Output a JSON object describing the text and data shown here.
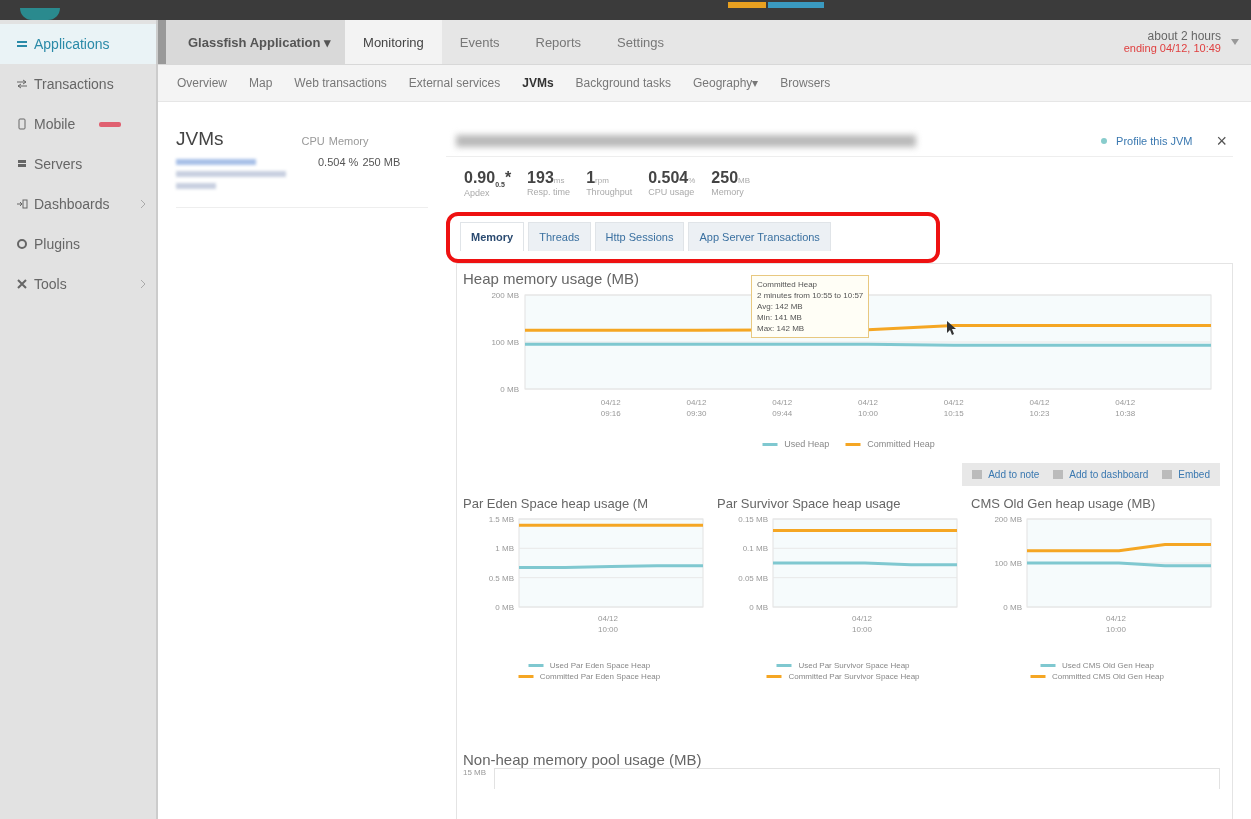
{
  "sidebar": {
    "items": [
      {
        "label": "Applications",
        "selected": true,
        "badge": false,
        "submenu": false
      },
      {
        "label": "Transactions",
        "selected": false,
        "badge": false,
        "submenu": false
      },
      {
        "label": "Mobile",
        "selected": false,
        "badge": true,
        "submenu": false
      },
      {
        "label": "Servers",
        "selected": false,
        "badge": false,
        "submenu": false
      },
      {
        "label": "Dashboards",
        "selected": false,
        "badge": false,
        "submenu": true
      },
      {
        "label": "Plugins",
        "selected": false,
        "badge": false,
        "submenu": false
      },
      {
        "label": "Tools",
        "selected": false,
        "badge": false,
        "submenu": true
      }
    ]
  },
  "app_selector": {
    "label": "Glassfish Application",
    "caret": "▾"
  },
  "main_tabs": [
    {
      "label": "Monitoring",
      "selected": true
    },
    {
      "label": "Events",
      "selected": false
    },
    {
      "label": "Reports",
      "selected": false
    },
    {
      "label": "Settings",
      "selected": false
    }
  ],
  "time_picker": {
    "range": "about 2 hours",
    "ending": "ending 04/12, 10:49"
  },
  "sub_tabs": [
    {
      "label": "Overview",
      "selected": false
    },
    {
      "label": "Map",
      "selected": false
    },
    {
      "label": "Web transactions",
      "selected": false
    },
    {
      "label": "External services",
      "selected": false
    },
    {
      "label": "JVMs",
      "selected": true
    },
    {
      "label": "Background tasks",
      "selected": false
    },
    {
      "label": "Geography",
      "selected": false,
      "caret": "▾"
    },
    {
      "label": "Browsers",
      "selected": false
    }
  ],
  "jvm_list": {
    "title": "JVMs",
    "columns": [
      "CPU",
      "Memory"
    ],
    "rows": [
      {
        "cpu": "0.504 %",
        "memory": "250 MB"
      }
    ]
  },
  "profile_link": "Profile this JVM",
  "close": "×",
  "metrics": [
    {
      "value": "0.90",
      "sub": "0.5",
      "suffix": "*",
      "label": "Apdex"
    },
    {
      "value": "193",
      "unit": "ms",
      "label": "Resp. time"
    },
    {
      "value": "1",
      "unit": "rpm",
      "label": "Throughput"
    },
    {
      "value": "0.504",
      "unit": "%",
      "label": "CPU usage"
    },
    {
      "value": "250",
      "unit": "MB",
      "label": "Memory"
    }
  ],
  "detail_tabs": [
    {
      "label": "Memory",
      "selected": true
    },
    {
      "label": "Threads",
      "selected": false
    },
    {
      "label": "Http Sessions",
      "selected": false
    },
    {
      "label": "App Server Transactions",
      "selected": false
    }
  ],
  "heap_chart": {
    "chart_data": {
      "type": "line",
      "title": "Heap memory usage (MB)",
      "categories": [
        null,
        "04/12 09:16",
        "04/12 09:30",
        "04/12 09:44",
        "04/12 10:00",
        "04/12 10:15",
        "04/12 10:23",
        "04/12 10:38",
        null
      ],
      "ylim": [
        0,
        200
      ],
      "yticks": [
        {
          "value": 0,
          "label": "0 MB"
        },
        {
          "value": 100,
          "label": "100 MB"
        },
        {
          "value": 200,
          "label": "200 MB"
        }
      ],
      "series": [
        {
          "name": "Used Heap",
          "color": "#7fc8d0",
          "values": [
            95,
            95,
            95,
            95,
            95,
            93,
            93,
            93,
            93
          ]
        },
        {
          "name": "Committed Heap",
          "color": "#f5a623",
          "values": [
            125,
            125,
            125,
            null,
            126,
            135,
            135,
            135,
            135
          ]
        }
      ]
    },
    "tooltip": [
      "Committed Heap",
      "2 minutes from 10:55 to 10:57",
      "Avg: 142 MB",
      "Min: 141 MB",
      "Max: 142 MB"
    ]
  },
  "actions": [
    "Add to note",
    "Add to dashboard",
    "Embed"
  ],
  "pool_charts": [
    {
      "title": "Par Eden Space heap usage (M",
      "y_labels": [
        "1.5 MB",
        "1 MB",
        "0.5 MB",
        "0 MB"
      ],
      "x_label": "04/12 10:00",
      "series": [
        {
          "name": "Used Par Eden Space Heap",
          "color": "#7fc8d0"
        },
        {
          "name": "Committed Par Eden Space Heap",
          "color": "#f5a623"
        }
      ]
    },
    {
      "title": "Par Survivor Space heap usage",
      "y_labels": [
        "0.15 MB",
        "0.1 MB",
        "0.05 MB",
        "0 MB"
      ],
      "x_label": "04/12 10:00",
      "series": [
        {
          "name": "Used Par Survivor Space Heap",
          "color": "#7fc8d0"
        },
        {
          "name": "Committed Par Survivor Space Heap",
          "color": "#f5a623"
        }
      ]
    },
    {
      "title": "CMS Old Gen heap usage (MB)",
      "y_labels": [
        "200 MB",
        "100 MB",
        "0 MB"
      ],
      "x_label": "04/12 10:00",
      "series": [
        {
          "name": "Used CMS Old Gen Heap",
          "color": "#7fc8d0"
        },
        {
          "name": "Committed CMS Old Gen Heap",
          "color": "#f5a623"
        }
      ]
    }
  ],
  "nonheap": {
    "title": "Non-heap memory pool usage (MB)",
    "top_tick": "15 MB"
  }
}
